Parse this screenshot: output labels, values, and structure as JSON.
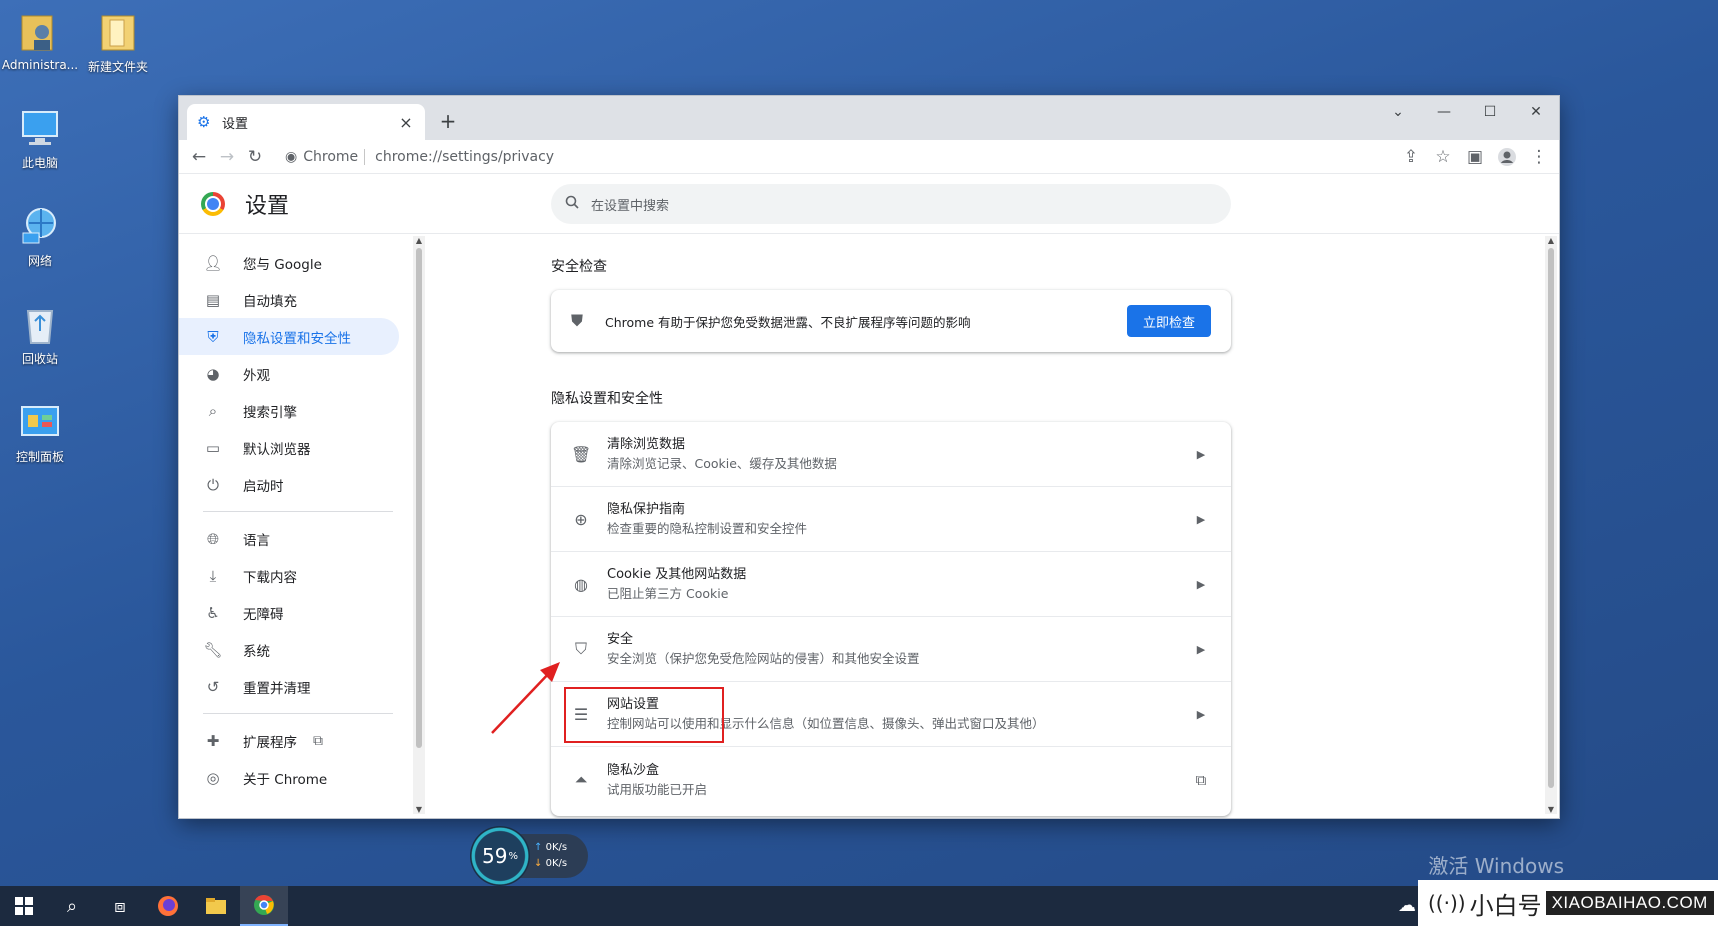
{
  "desktop": {
    "icons": [
      {
        "label": "Administra..."
      },
      {
        "label": "新建文件夹"
      },
      {
        "label": "此电脑"
      },
      {
        "label": "网络"
      },
      {
        "label": "回收站"
      },
      {
        "label": "控制面板"
      }
    ],
    "activate_text": "激活 Windows"
  },
  "browser": {
    "tab_title": "设置",
    "tab_close": "×",
    "new_tab": "+",
    "omnibox_site": "Chrome",
    "omnibox_url": "chrome://settings/privacy"
  },
  "settings": {
    "title": "设置",
    "search_placeholder": "在设置中搜索",
    "nav": [
      {
        "label": "您与 Google"
      },
      {
        "label": "自动填充"
      },
      {
        "label": "隐私设置和安全性"
      },
      {
        "label": "外观"
      },
      {
        "label": "搜索引擎"
      },
      {
        "label": "默认浏览器"
      },
      {
        "label": "启动时"
      },
      {
        "label": "语言"
      },
      {
        "label": "下载内容"
      },
      {
        "label": "无障碍"
      },
      {
        "label": "系统"
      },
      {
        "label": "重置并清理"
      },
      {
        "label": "扩展程序"
      },
      {
        "label": "关于 Chrome"
      }
    ],
    "safety_check": {
      "title": "安全检查",
      "text": "Chrome 有助于保护您免受数据泄露、不良扩展程序等问题的影响",
      "button": "立即检查"
    },
    "privacy": {
      "title": "隐私设置和安全性",
      "rows": [
        {
          "title": "清除浏览数据",
          "subtitle": "清除浏览记录、Cookie、缓存及其他数据"
        },
        {
          "title": "隐私保护指南",
          "subtitle": "检查重要的隐私控制设置和安全控件"
        },
        {
          "title": "Cookie 及其他网站数据",
          "subtitle": "已阻止第三方 Cookie"
        },
        {
          "title": "安全",
          "subtitle": "安全浏览（保护您免受危险网站的侵害）和其他安全设置"
        },
        {
          "title": "网站设置",
          "subtitle": "控制网站可以使用和显示什么信息（如位置信息、摄像头、弹出式窗口及其他）"
        },
        {
          "title": "隐私沙盒",
          "subtitle": "试用版功能已开启"
        }
      ]
    }
  },
  "widget": {
    "percent": "59",
    "percent_unit": "%",
    "upload": "0K/s",
    "download": "0K/s"
  },
  "watermark": {
    "brand_cn": "小白号",
    "brand_en": "XIAOBAIHAO.COM"
  },
  "colors": {
    "accent": "#1a73e8",
    "highlight": "#e02020"
  }
}
